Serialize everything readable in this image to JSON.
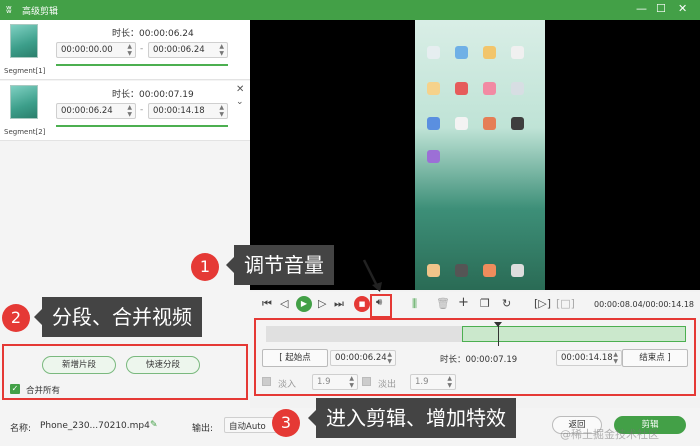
{
  "window": {
    "title": "高级剪辑",
    "minimize": "—",
    "maximize": "☐",
    "close": "✕"
  },
  "segments": [
    {
      "label": "Segment[1]",
      "duration": "时长：00:00:06.24",
      "start": "00:00:00.00",
      "end": "00:00:06.24",
      "dash": "-"
    },
    {
      "label": "Segment[2]",
      "duration": "时长：00:00:07.19",
      "start": "00:00:06.24",
      "end": "00:00:14.18",
      "dash": "-"
    }
  ],
  "left_controls": {
    "add_segment": "新增片段",
    "quick_split": "快速分段",
    "merge_all": "合并所有"
  },
  "player": {
    "time": "00:00:08.04/00:00:14.18"
  },
  "edit": {
    "start_btn": "[ 起始点",
    "start_value": "00:00:06.24",
    "duration": "时长：00:00:07.19",
    "end_value": "00:00:14.18",
    "end_btn": "结束点 ]",
    "fade_in": "淡入",
    "fade_in_value": "1.9",
    "fade_out": "淡出",
    "fade_out_value": "1.9"
  },
  "bottom": {
    "name_label": "名称:",
    "name_value": "Phone_230...70210.mp4",
    "output_label": "输出:",
    "output_value": "自动Auto",
    "back": "返回",
    "edit": "剪辑"
  },
  "annotations": [
    {
      "number": "1",
      "text": "调节音量"
    },
    {
      "number": "2",
      "text": "分段、合并视频"
    },
    {
      "number": "3",
      "text": "进入剪辑、增加特效"
    }
  ],
  "watermark": "@稀土掘金技术社区",
  "colors": {
    "accent": "#43a047",
    "annotation_red": "#e53935"
  }
}
